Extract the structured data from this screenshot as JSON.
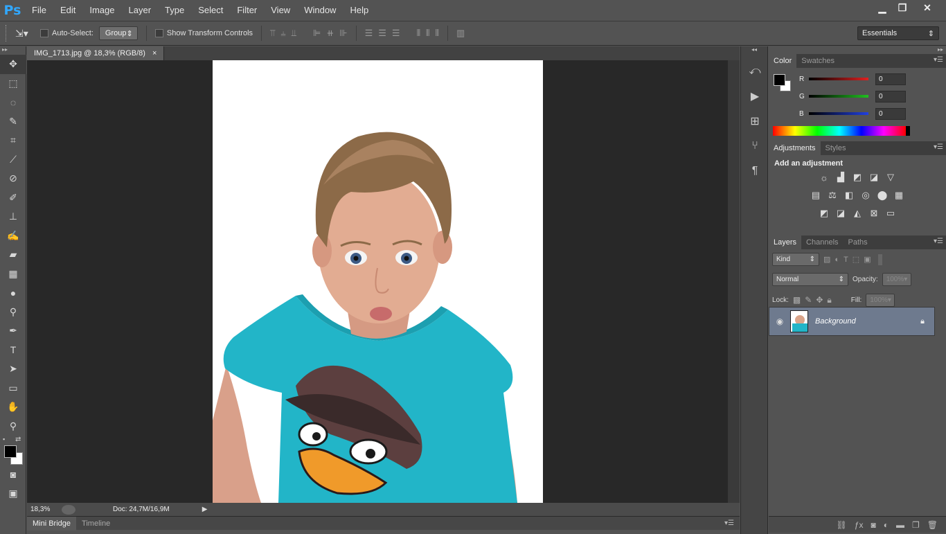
{
  "app": {
    "logo": "Ps"
  },
  "menu": [
    "File",
    "Edit",
    "Image",
    "Layer",
    "Type",
    "Select",
    "Filter",
    "View",
    "Window",
    "Help"
  ],
  "window_controls": {
    "minimize": "▁",
    "restore": "❐",
    "close": "✕"
  },
  "options": {
    "auto_select_label": "Auto-Select:",
    "auto_select_value": "Group",
    "show_transform_label": "Show Transform Controls",
    "workspace": "Essentials"
  },
  "document": {
    "tab_title": "IMG_1713.jpg @ 18,3% (RGB/8)",
    "close_glyph": "×",
    "zoom": "18,3%",
    "doc_size": "Doc: 24,7M/16,9M"
  },
  "bottom_tabs": [
    "Mini Bridge",
    "Timeline"
  ],
  "color_panel": {
    "tabs": [
      "Color",
      "Swatches"
    ],
    "channels": [
      {
        "label": "R",
        "value": "0",
        "color": "#e02020"
      },
      {
        "label": "G",
        "value": "0",
        "color": "#20c020"
      },
      {
        "label": "B",
        "value": "0",
        "color": "#2040e0"
      }
    ],
    "foreground": "#000000",
    "background": "#ffffff"
  },
  "adjustments_panel": {
    "tabs": [
      "Adjustments",
      "Styles"
    ],
    "title": "Add an adjustment"
  },
  "layers_panel": {
    "tabs": [
      "Layers",
      "Channels",
      "Paths"
    ],
    "kind_label": "Kind",
    "blend_mode": "Normal",
    "opacity_label": "Opacity:",
    "opacity_value": "100%",
    "lock_label": "Lock:",
    "fill_label": "Fill:",
    "fill_value": "100%",
    "layer_name": "Background"
  }
}
